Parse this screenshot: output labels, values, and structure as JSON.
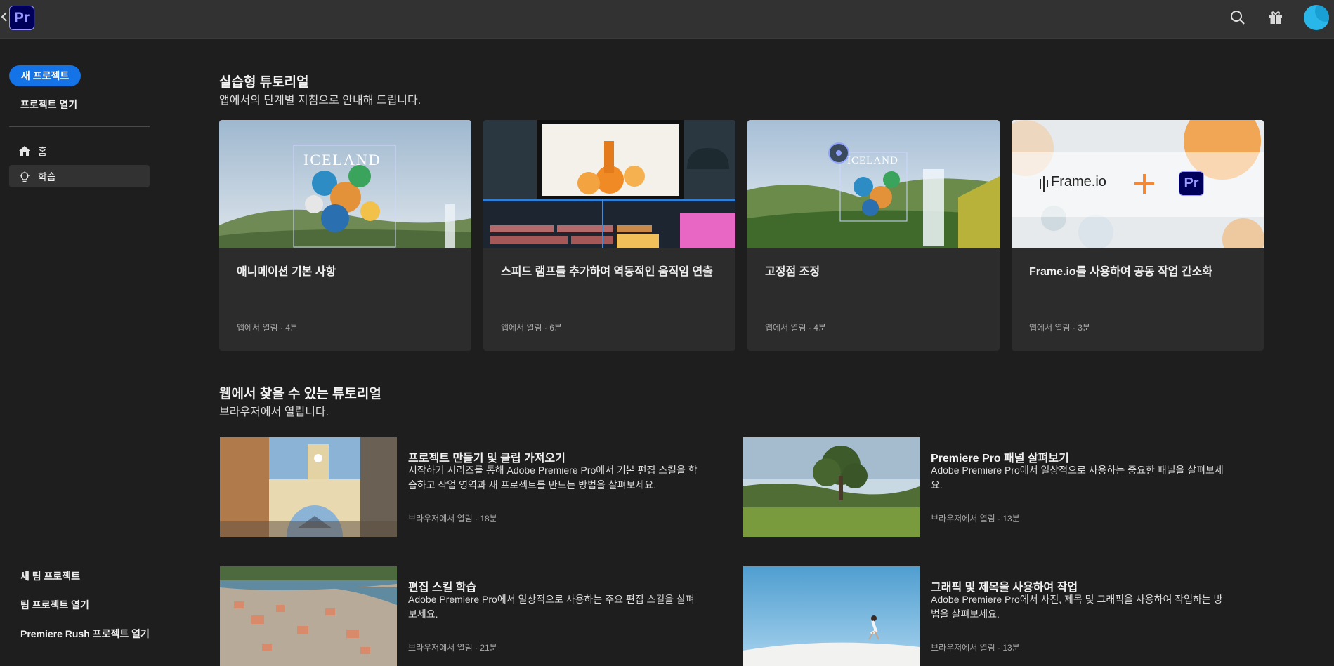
{
  "app": {
    "logo_text": "Pr",
    "accent": "#1473e6",
    "logo_bg": "#00005b",
    "logo_fg": "#9999ff"
  },
  "topbar": {
    "back_icon": "chevron-left-icon",
    "icons": [
      "search-icon",
      "gift-icon"
    ],
    "avatar": "user-avatar"
  },
  "sidebar": {
    "new_project": "새 프로젝트",
    "open_project": "프로젝트 열기",
    "nav": [
      {
        "label": "홈",
        "icon": "home-icon",
        "active": false
      },
      {
        "label": "학습",
        "icon": "lightbulb-icon",
        "active": true
      }
    ],
    "bottom": [
      "새 팀 프로젝트",
      "팀 프로젝트 열기",
      "Premiere Rush 프로젝트 열기"
    ]
  },
  "hands_on": {
    "title": "실습형 튜토리얼",
    "subtitle": "앱에서의 단계별 지침으로 안내해 드립니다.",
    "cards": [
      {
        "title": "애니메이션 기본 사항",
        "meta": "앱에서 열림 · 4분",
        "thumb_text": "ICELAND"
      },
      {
        "title": "스피드 램프를 추가하여 역동적인 움직임 연출",
        "meta": "앱에서 열림 · 6분",
        "thumb_text": ""
      },
      {
        "title": "고정점 조정",
        "meta": "앱에서 열림 · 4분",
        "thumb_text": "ICELAND"
      },
      {
        "title": "Frame.io를 사용하여 공동 작업 간소화",
        "meta": "앱에서 열림 · 3분",
        "thumb_text": "Frame.io",
        "thumb_logo": "Pr"
      }
    ]
  },
  "web": {
    "title": "웹에서 찾을 수 있는 튜토리얼",
    "subtitle": "브라우저에서 열립니다.",
    "items": [
      {
        "title": "프로젝트 만들기 및 클립 가져오기",
        "desc": "시작하기 시리즈를 통해 Adobe Premiere Pro에서 기본 편집 스킬을 학습하고 작업 영역과 새 프로젝트를 만드는 방법을 살펴보세요.",
        "meta": "브라우저에서 열림 · 18분"
      },
      {
        "title": "Premiere Pro 패널 살펴보기",
        "desc": "Adobe Premiere Pro에서 일상적으로 사용하는 중요한 패널을 살펴보세요.",
        "meta": "브라우저에서 열림 · 13분"
      },
      {
        "title": "편집 스킬 학습",
        "desc": "Adobe Premiere Pro에서 일상적으로 사용하는 주요 편집 스킬을 살펴보세요.",
        "meta": "브라우저에서 열림 · 21분"
      },
      {
        "title": "그래픽 및 제목을 사용하여 작업",
        "desc": "Adobe Premiere Pro에서 사진, 제목 및 그래픽을 사용하여 작업하는 방법을 살펴보세요.",
        "meta": "브라우저에서 열림 · 13분"
      }
    ]
  }
}
